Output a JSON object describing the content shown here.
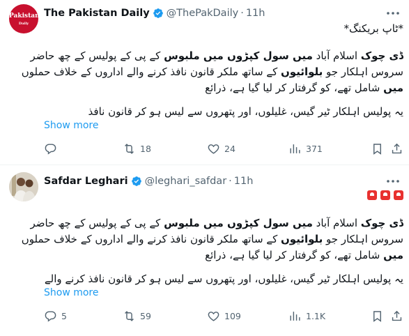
{
  "tweets": [
    {
      "display_name": "The Pakistan Daily",
      "handle": "@ThePakDaily",
      "separator": "·",
      "time": "11h",
      "avatar_text": [
        "Pakistan",
        "Daily"
      ],
      "text_lines": [
        [
          {
            "t": "*ٹاپ بریکنگ*",
            "b": false
          }
        ],
        [
          {
            "t": "ڈی چوک",
            "b": true
          },
          {
            "t": "  اسلام آباد ",
            "b": false
          },
          {
            "t": "میں سول کپڑوں میں ملبوس",
            "b": true
          },
          {
            "t": " کے پی کے پولیس کے چھ  حاضر",
            "b": false
          }
        ],
        [
          {
            "t": "سروس اہلکار جو ",
            "b": false
          },
          {
            "t": "بلوائیوں",
            "b": true
          },
          {
            "t": " کے ساتھ ملکر قانون نافذ کرنے  والے اداروں کے خلاف حملوں",
            "b": false
          }
        ],
        [
          {
            "t": "میں",
            "b": true
          },
          {
            "t": " شامل تھے، کو گرفتار کر لیا گیا ہے، ذرائع",
            "b": false
          }
        ],
        [
          {
            "t": "یہ پولیس اہلکار ٹیر گیس، غلیلوں، اور پتھروں سے لیس ہو کر قانون نافذ",
            "b": false
          }
        ]
      ],
      "show_more": "Show more",
      "actions": {
        "replies": "",
        "reposts": "18",
        "likes": "24",
        "views": "371"
      }
    },
    {
      "display_name": "Safdar Leghari",
      "handle": "@leghari_safdar",
      "separator": "·",
      "time": "11h",
      "emoji_name": "police-light-emoji",
      "text_lines": [
        [
          {
            "t": "ڈی چوک",
            "b": true
          },
          {
            "t": "  اسلام آباد ",
            "b": false
          },
          {
            "t": "میں سول کپڑوں میں ملبوس",
            "b": true
          },
          {
            "t": " کے پی کے پولیس کے چھ  حاضر",
            "b": false
          }
        ],
        [
          {
            "t": "سروس اہلکار جو ",
            "b": false
          },
          {
            "t": "بلوائیوں",
            "b": true
          },
          {
            "t": " کے ساتھ ملکر قانون نافذ کرنے  والے اداروں کے خلاف حملوں",
            "b": false
          }
        ],
        [
          {
            "t": "میں",
            "b": true
          },
          {
            "t": " شامل تھے، کو گرفتار کر لیا گیا ہے، ذرائع",
            "b": false
          }
        ],
        [
          {
            "t": "یہ پولیس اہلکار ٹیر گیس، غلیلوں، اور پتھروں سے لیس ہو کر قانون نافذ کرنے  والے",
            "b": false
          }
        ]
      ],
      "show_more": "Show more",
      "actions": {
        "replies": "5",
        "reposts": "59",
        "likes": "109",
        "views": "1.1K"
      }
    }
  ],
  "colors": {
    "accent": "#1d9bf0",
    "secondary_text": "#536471",
    "logo_red": "#c8102e"
  },
  "icons": [
    "verified-badge-icon",
    "more-icon",
    "reply-icon",
    "repost-icon",
    "like-icon",
    "views-icon",
    "bookmark-icon",
    "share-icon"
  ]
}
